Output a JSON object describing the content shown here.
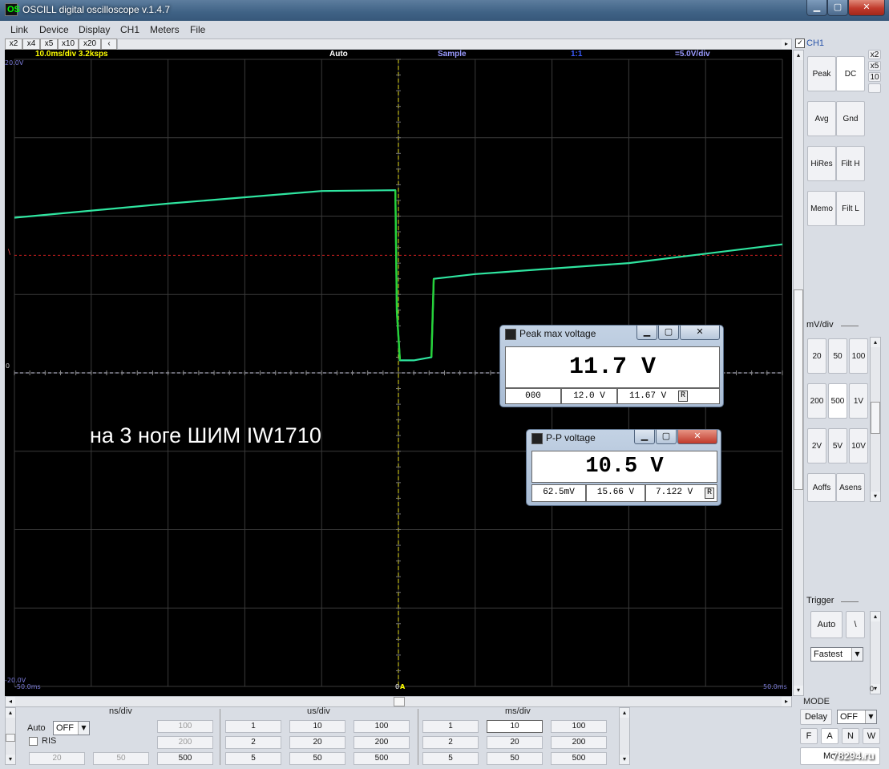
{
  "window": {
    "title": "OSCILL digital oscilloscope  v.1.4.7",
    "app_icon_text": "OS",
    "min_glyph": "▁",
    "max_glyph": "▢",
    "close_glyph": "✕"
  },
  "menu": [
    "Link",
    "Device",
    "Display",
    "CH1",
    "Meters",
    "File"
  ],
  "zoom_buttons": [
    "x2",
    "x4",
    "x5",
    "x10",
    "x20",
    "‹"
  ],
  "status": {
    "timebase": "10.0ms/div  3.2ksps",
    "trigger_mode": "Auto",
    "acq_mode": "Sample",
    "ratio": "1:1",
    "volts_div": "=5.0V/div"
  },
  "scope_labels": {
    "y_top": "20.0V",
    "y_bottom": "-20.0V",
    "x_left": "-50.0ms",
    "x_right": "50.0ms",
    "zero": "0",
    "trigger_level_mark": "\\",
    "trigger_pos_mark": "0",
    "trigger_arrow": "A"
  },
  "annotation": "на 3 ноге ШИМ IW1710",
  "trace": {
    "color": "#2fe5a0",
    "samples_ms": [
      -50,
      -30,
      -10,
      -0.4,
      -0.2,
      0.2,
      2.0,
      4.3,
      4.6,
      10,
      30,
      50
    ],
    "samples_v": [
      9.9,
      10.8,
      11.6,
      11.65,
      3.9,
      0.8,
      0.8,
      1.0,
      6.0,
      6.3,
      7.0,
      8.2
    ]
  },
  "trigger_level_v": 7.5,
  "right_panel": {
    "ch_label": "CH1",
    "ch_checked": true,
    "mult": [
      "x2",
      "x5",
      "10",
      ""
    ],
    "mode_buttons": [
      "Peak",
      "DC",
      "Avg",
      "Gnd",
      "HiRes",
      "Filt H",
      "Memo",
      "Filt L"
    ],
    "mv_div_label": "mV/div",
    "volt_buttons": [
      "20",
      "50",
      "100",
      "200",
      "500",
      "1V",
      "2V",
      "5V",
      "10V"
    ],
    "offset_buttons": [
      "Aoffs",
      "Asens"
    ],
    "trigger_label": "Trigger",
    "trigger_auto": "Auto",
    "trigger_slope": "\\",
    "trigger_speed": "Fastest",
    "scroll_value": "0"
  },
  "bottom": {
    "ns": {
      "title": "ns/div",
      "auto_label": "Auto",
      "auto_value": "OFF",
      "ris_label": "RIS",
      "buttons": [
        "100",
        "200",
        "20",
        "50",
        "500"
      ]
    },
    "us": {
      "title": "us/div",
      "buttons": [
        "1",
        "10",
        "100",
        "2",
        "20",
        "200",
        "5",
        "50",
        "500"
      ]
    },
    "ms": {
      "title": "ms/div",
      "buttons": [
        "1",
        "10",
        "100",
        "2",
        "20",
        "200",
        "5",
        "50",
        "500"
      ]
    },
    "mode": {
      "title": "MODE",
      "delay_label": "Delay",
      "delay_value": "OFF",
      "buttons": [
        "F",
        "A",
        "N",
        "W"
      ],
      "mo_label": "Mo"
    }
  },
  "meters": {
    "peak": {
      "title": "Peak max voltage",
      "value": "11.7 V",
      "cells": [
        "000",
        "12.0 V",
        "11.67 V"
      ],
      "flag": "R"
    },
    "pp": {
      "title": "P-P voltage",
      "value": "10.5 V",
      "cells": [
        "62.5mV",
        "15.66 V",
        "7.122 V"
      ],
      "flag": "R"
    }
  },
  "watermark": "78294.ru"
}
